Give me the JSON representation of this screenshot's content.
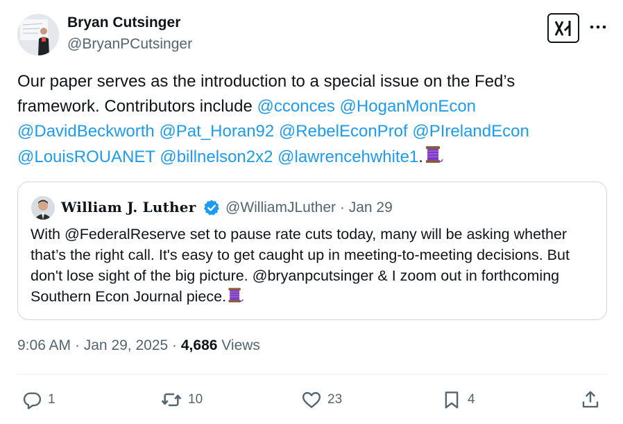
{
  "author": {
    "name": "Bryan Cutsinger",
    "handle": "@BryanPCutsinger"
  },
  "tweet": {
    "segments": [
      {
        "text": "Our paper serves as the introduction to a special issue on the Fed’s framework. Contributors include ",
        "type": "text"
      },
      {
        "text": "@cconces",
        "type": "mention"
      },
      {
        "text": " ",
        "type": "text"
      },
      {
        "text": "@HoganMonEcon",
        "type": "mention"
      },
      {
        "text": " ",
        "type": "text"
      },
      {
        "text": "@DavidBeckworth",
        "type": "mention"
      },
      {
        "text": " ",
        "type": "text"
      },
      {
        "text": "@Pat_Horan92",
        "type": "mention"
      },
      {
        "text": " ",
        "type": "text"
      },
      {
        "text": "@RebelEconProf",
        "type": "mention"
      },
      {
        "text": " ",
        "type": "text"
      },
      {
        "text": "@PIrelandEcon",
        "type": "mention"
      },
      {
        "text": " ",
        "type": "text"
      },
      {
        "text": "@LouisROUANET",
        "type": "mention"
      },
      {
        "text": " ",
        "type": "text"
      },
      {
        "text": "@billnelson2x2",
        "type": "mention"
      },
      {
        "text": " ",
        "type": "text"
      },
      {
        "text": "@lawrencehwhite1",
        "type": "mention"
      },
      {
        "text": ".",
        "type": "text"
      }
    ],
    "emoji": "thread-spool-emoji"
  },
  "quote": {
    "name": "William J. Luther",
    "handle": "@WilliamJLuther",
    "separator": "·",
    "date": "Jan 29",
    "text": "With @FederalReserve set to pause rate cuts today, many will be asking whether that’s the right call. It's easy to get caught up in meeting-to-meeting decisions. But don't lose sight of the big picture. @bryanpcutsinger & I zoom out in forthcoming Southern Econ Journal piece.",
    "emoji": "thread-spool-emoji"
  },
  "meta": {
    "time": "9:06 AM",
    "separator1": "·",
    "date": "Jan 29, 2025",
    "separator2": "·",
    "views_count": "4,686",
    "views_label": "Views"
  },
  "actions": {
    "replies": "1",
    "reposts": "10",
    "likes": "23",
    "bookmarks": "4"
  },
  "colors": {
    "text": "#0f1419",
    "secondary": "#536471",
    "link": "#1d9bf0",
    "verified": "#1d9bf0",
    "border": "#cfd9de"
  },
  "icons": [
    "grok-icon",
    "more-icon",
    "verified-badge-icon",
    "reply-icon",
    "repost-icon",
    "like-icon",
    "bookmark-icon",
    "share-icon"
  ]
}
